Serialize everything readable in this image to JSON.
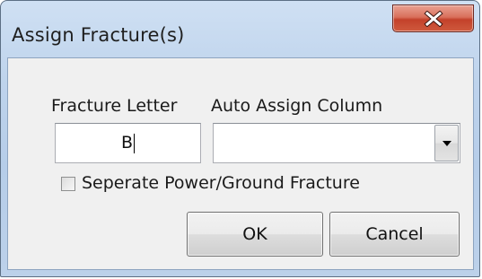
{
  "window": {
    "title": "Assign Fracture(s)",
    "close_icon": "close-x-icon"
  },
  "form": {
    "fracture_letter_label": "Fracture Letter",
    "fracture_letter_value": "B",
    "auto_assign_label": "Auto Assign Column",
    "auto_assign_value": "",
    "dropdown_icon": "chevron-down-icon",
    "separate_checkbox_label": "Seperate Power/Ground Fracture",
    "separate_checked": false
  },
  "buttons": {
    "ok_label": "OK",
    "cancel_label": "Cancel"
  },
  "colors": {
    "titlebar": "#bed3ec",
    "close_button": "#c3412a",
    "client_background": "#f0f0f0"
  }
}
